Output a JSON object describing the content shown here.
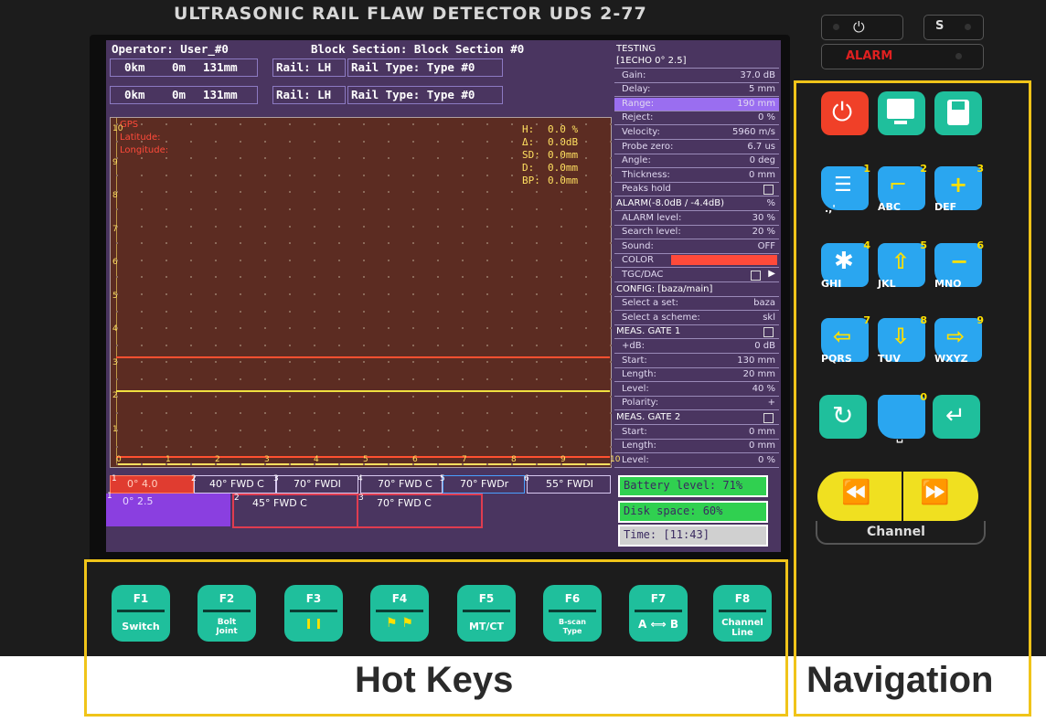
{
  "device": {
    "title": "ULTRASONIC  RAIL  FLAW  DETECTOR   UDS 2-77",
    "alarm_label": "ALARM",
    "s_label": "S"
  },
  "header": {
    "operator": "Operator: User_#0",
    "block_section": "Block Section: Block Section #0",
    "row1": {
      "km": "0km",
      "m": "0m",
      "mm": "131mm",
      "rail": "Rail: LH",
      "rail_type": "Rail Type: Type #0"
    },
    "row2": {
      "km": "0km",
      "m": "0m",
      "mm": "131mm",
      "rail": "Rail: LH",
      "rail_type": "Rail Type: Type #0"
    }
  },
  "gps": {
    "title": "GPS",
    "latitude": "Latitude:",
    "longitude": "Longitude:"
  },
  "measurements": [
    {
      "label": "H:",
      "value": "0.0 %"
    },
    {
      "label": "Δ:",
      "value": "0.0dB"
    },
    {
      "label": "SD:",
      "value": "0.0mm"
    },
    {
      "label": "D:",
      "value": "0.0mm"
    },
    {
      "label": "BP:",
      "value": "0.0mm"
    }
  ],
  "axis": {
    "y_ticks": [
      "1",
      "2",
      "3",
      "4",
      "5",
      "6",
      "7",
      "8",
      "9",
      "10"
    ],
    "x_ticks": [
      "0",
      "1",
      "2",
      "3",
      "4",
      "5",
      "6",
      "7",
      "8",
      "9",
      "10"
    ]
  },
  "settings": {
    "title": "TESTING",
    "rows": [
      {
        "label": "[1ECHO  0° 2.5]",
        "value": "",
        "type": "sec"
      },
      {
        "label": "Gain:",
        "value": "37.0 dB"
      },
      {
        "label": "Delay:",
        "value": "5 mm"
      },
      {
        "label": "Range:",
        "value": "190 mm",
        "type": "hl"
      },
      {
        "label": "Reject:",
        "value": "0 %"
      },
      {
        "label": "Velocity:",
        "value": "5960 m/s"
      },
      {
        "label": "Probe zero:",
        "value": "6.7 us"
      },
      {
        "label": "Angle:",
        "value": "0 deg"
      },
      {
        "label": "Thickness:",
        "value": "0 mm"
      },
      {
        "label": "Peaks hold",
        "value": "",
        "type": "chk"
      },
      {
        "label": "ALARM(-8.0dB / -4.4dB)",
        "value": "%",
        "type": "sec"
      },
      {
        "label": "ALARM level:",
        "value": "30 %"
      },
      {
        "label": "Search level:",
        "value": "20 %"
      },
      {
        "label": "Sound:",
        "value": "OFF"
      },
      {
        "label": "COLOR",
        "value": "",
        "type": "color"
      },
      {
        "label": "TGC/DAC",
        "value": "",
        "type": "chkarrow"
      },
      {
        "label": "CONFIG: [baza/main]",
        "value": "",
        "type": "sec"
      },
      {
        "label": "Select a set:",
        "value": "baza"
      },
      {
        "label": "Select a scheme:",
        "value": "skl"
      },
      {
        "label": "MEAS. GATE 1",
        "value": "",
        "type": "secchk"
      },
      {
        "label": "+dB:",
        "value": "0 dB"
      },
      {
        "label": "Start:",
        "value": "130 mm"
      },
      {
        "label": "Length:",
        "value": "20 mm"
      },
      {
        "label": "Level:",
        "value": "40 %"
      },
      {
        "label": "Polarity:",
        "value": "+"
      },
      {
        "label": "MEAS. GATE 2",
        "value": "",
        "type": "secchk"
      },
      {
        "label": "Start:",
        "value": "0 mm"
      },
      {
        "label": "Length:",
        "value": "0 mm"
      },
      {
        "label": "Level:",
        "value": "0 %"
      }
    ]
  },
  "status": {
    "battery": "Battery level: 71%",
    "disk": "Disk space:   60%",
    "time": "Time:        [11:43]"
  },
  "channels_row1": [
    {
      "num": "1",
      "label": "0° 4.0"
    },
    {
      "num": "2",
      "label": "40° FWD C"
    },
    {
      "num": "3",
      "label": "70° FWDI"
    },
    {
      "num": "4",
      "label": "70° FWD C"
    },
    {
      "num": "5",
      "label": "70° FWDr"
    },
    {
      "num": "6",
      "label": "55° FWDI"
    }
  ],
  "channels_row2": [
    {
      "num": "1",
      "label": "0° 2.5"
    },
    {
      "num": "2",
      "label": "45° FWD C"
    },
    {
      "num": "3",
      "label": "70° FWD C"
    }
  ],
  "hotkeys": [
    {
      "fn": "F1",
      "label": "Switch"
    },
    {
      "fn": "F2",
      "label": "Bolt Joint"
    },
    {
      "fn": "F3",
      "label": ""
    },
    {
      "fn": "F4",
      "label": ""
    },
    {
      "fn": "F5",
      "label": "MT/CT"
    },
    {
      "fn": "F6",
      "label": "B-scan Type"
    },
    {
      "fn": "F7",
      "label": "A ⟺ B"
    },
    {
      "fn": "F8",
      "label": "Channel Line"
    }
  ],
  "keypad": [
    {
      "num": "1",
      "sub": ".,'"
    },
    {
      "num": "2",
      "sub": "ABC"
    },
    {
      "num": "3",
      "sub": "DEF"
    },
    {
      "num": "4",
      "sub": "GHI"
    },
    {
      "num": "5",
      "sub": "JKL"
    },
    {
      "num": "6",
      "sub": "MNO"
    },
    {
      "num": "7",
      "sub": "PQRS"
    },
    {
      "num": "8",
      "sub": "TUV"
    },
    {
      "num": "9",
      "sub": "WXYZ"
    },
    {
      "num": "0",
      "sub": "␣"
    }
  ],
  "channel_label": "Channel",
  "captions": {
    "hotkeys": "Hot Keys",
    "navigation": "Navigation"
  },
  "colors": {
    "accent": "#f0c419",
    "key_green": "#1fbf9c",
    "key_blue": "#2aa6f0",
    "screen_bg": "#4a3560",
    "plot_bg": "#5c2c22"
  }
}
